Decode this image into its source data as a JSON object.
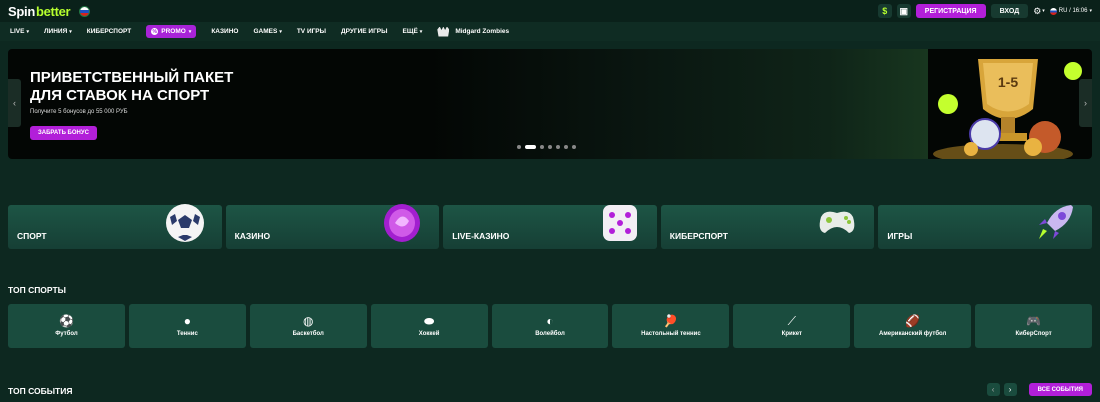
{
  "header": {
    "logo_spin": "Spin",
    "logo_better": "better",
    "register_label": "РЕГИСТРАЦИЯ",
    "login_label": "ВХОД",
    "lang_time": "RU / 16:06"
  },
  "nav": {
    "items": [
      {
        "label": "LIVE"
      },
      {
        "label": "ЛИНИЯ"
      },
      {
        "label": "КИБЕРСПОРТ"
      },
      {
        "label": "PROMO"
      },
      {
        "label": "КАЗИНО"
      },
      {
        "label": "GAMES"
      },
      {
        "label": "TV ИГРЫ"
      },
      {
        "label": "ДРУГИЕ ИГРЫ"
      },
      {
        "label": "ЕЩЁ"
      },
      {
        "label": "Midgard Zombies"
      }
    ]
  },
  "banner": {
    "title_line1": "ПРИВЕТСТВЕННЫЙ ПАКЕТ",
    "title_line2": "ДЛЯ СТАВОК НА СПОРТ",
    "subtitle": "Получите 5 бонусов до 55 000 РУБ",
    "button_label": "ЗАБРАТЬ БОНУС",
    "trophy_text": "1-5",
    "slide_count": 7,
    "active_slide": 2
  },
  "categories": [
    {
      "label": "СПОРТ",
      "icon": "soccer-ball-icon"
    },
    {
      "label": "КАЗИНО",
      "icon": "casino-chip-icon"
    },
    {
      "label": "LIVE-КАЗИНО",
      "icon": "dice-icon"
    },
    {
      "label": "КИБЕРСПОРТ",
      "icon": "gamepad-icon"
    },
    {
      "label": "ИГРЫ",
      "icon": "rocket-icon"
    }
  ],
  "top_sports": {
    "title": "ТОП СПОРТЫ",
    "items": [
      {
        "label": "Футбол",
        "icon": "⚽"
      },
      {
        "label": "Теннис",
        "icon": "●"
      },
      {
        "label": "Баскетбол",
        "icon": "◍"
      },
      {
        "label": "Хоккей",
        "icon": "⬬"
      },
      {
        "label": "Волейбол",
        "icon": "◐"
      },
      {
        "label": "Настольный теннис",
        "icon": "🏓"
      },
      {
        "label": "Крикет",
        "icon": "⟋"
      },
      {
        "label": "Американский футбол",
        "icon": "🏈"
      },
      {
        "label": "КиберСпорт",
        "icon": "🎮"
      }
    ]
  },
  "top_events": {
    "title": "ТОП СОБЫТИЯ",
    "all_events_label": "ВСЕ СОБЫТИЯ"
  },
  "colors": {
    "accent": "#b21fd9",
    "brand_green": "#b6ff2e",
    "background": "#0d2820"
  }
}
